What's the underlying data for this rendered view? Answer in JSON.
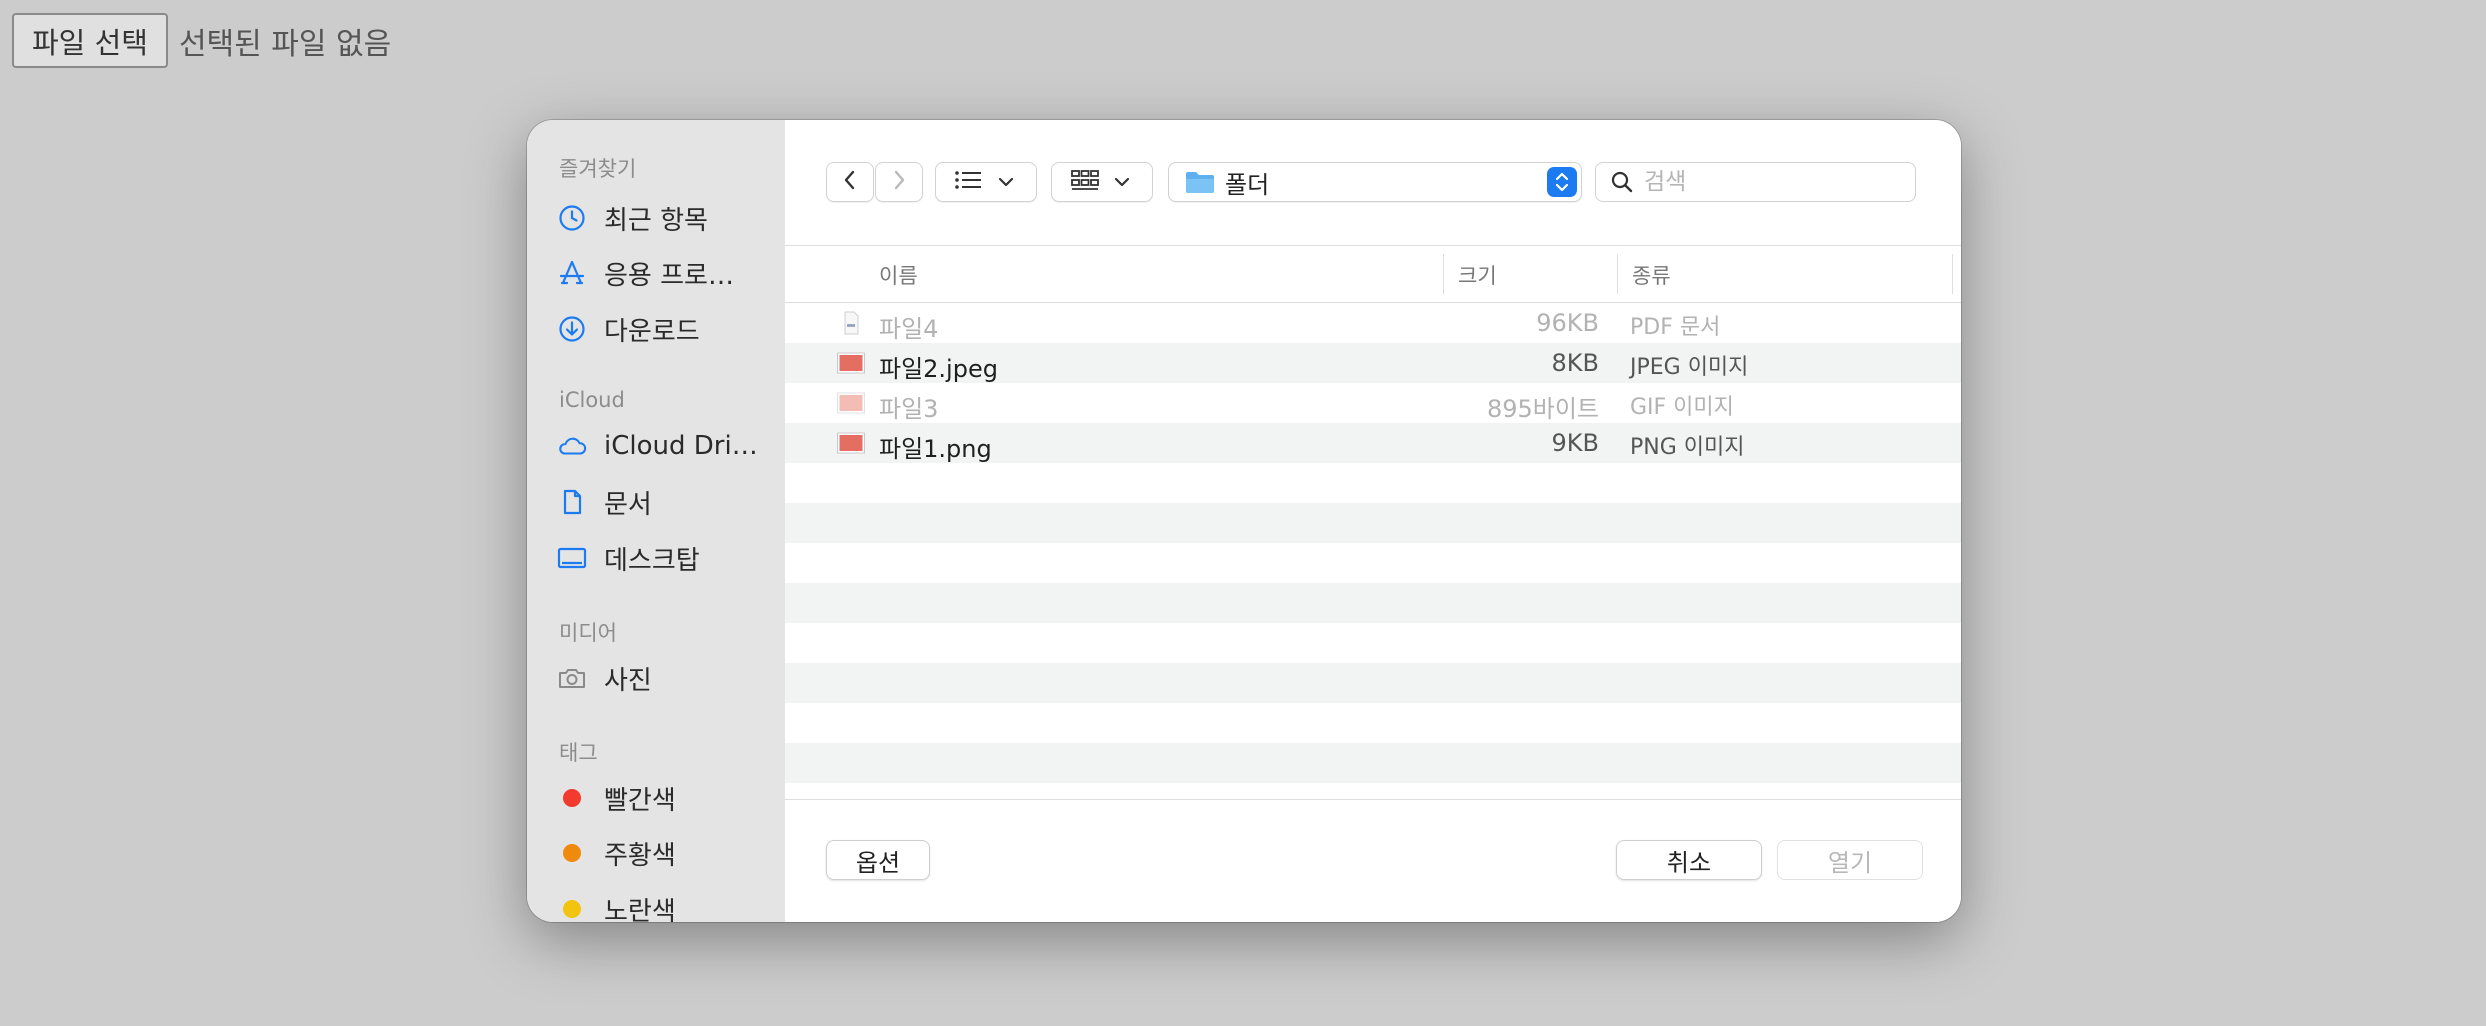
{
  "host": {
    "choose_file_label": "파일 선택",
    "no_file_text": "선택된 파일 없음"
  },
  "sidebar": {
    "sections": [
      {
        "title": "즐겨찾기",
        "items": [
          {
            "label": "최근 항목",
            "icon": "clock-icon"
          },
          {
            "label": "응용 프로…",
            "icon": "applications-icon"
          },
          {
            "label": "다운로드",
            "icon": "download-icon"
          }
        ]
      },
      {
        "title": "iCloud",
        "items": [
          {
            "label": "iCloud Dri…",
            "icon": "cloud-icon"
          },
          {
            "label": "문서",
            "icon": "document-icon"
          },
          {
            "label": "데스크탑",
            "icon": "desktop-icon"
          }
        ]
      },
      {
        "title": "미디어",
        "items": [
          {
            "label": "사진",
            "icon": "camera-icon"
          }
        ]
      },
      {
        "title": "태그",
        "items": [
          {
            "label": "빨간색",
            "color": "#f23a2f"
          },
          {
            "label": "주황색",
            "color": "#f08a0c"
          },
          {
            "label": "노란색",
            "color": "#f2c40f"
          }
        ]
      }
    ]
  },
  "toolbar": {
    "folder_name": "폴더",
    "search_placeholder": "검색",
    "accent_color": "#1d7bf2"
  },
  "columns": {
    "name": "이름",
    "size": "크기",
    "kind": "종류"
  },
  "files": [
    {
      "name": "파일4",
      "size": "96KB",
      "kind": "PDF 문서",
      "enabled": false,
      "icon": "pdf-file-icon"
    },
    {
      "name": "파일2.jpeg",
      "size": "8KB",
      "kind": "JPEG 이미지",
      "enabled": true,
      "icon": "image-file-icon"
    },
    {
      "name": "파일3",
      "size": "895바이트",
      "kind": "GIF 이미지",
      "enabled": false,
      "icon": "image-file-icon"
    },
    {
      "name": "파일1.png",
      "size": "9KB",
      "kind": "PNG 이미지",
      "enabled": true,
      "icon": "image-file-icon"
    }
  ],
  "footer": {
    "options_label": "옵션",
    "cancel_label": "취소",
    "open_label": "열기"
  }
}
